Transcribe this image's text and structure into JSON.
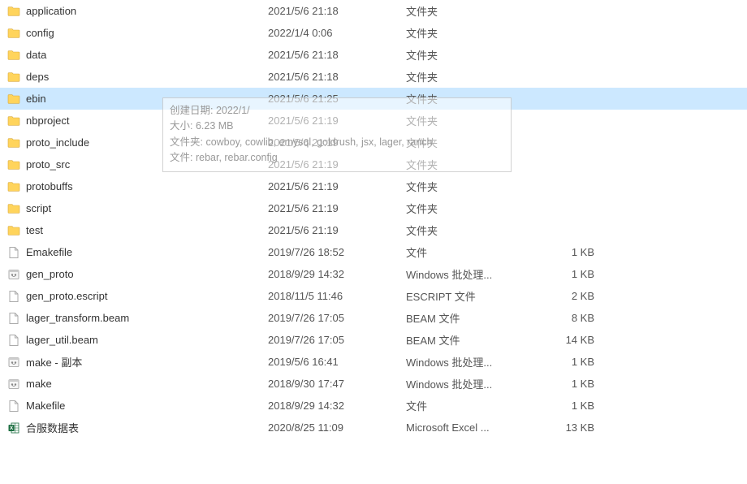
{
  "tooltip": {
    "line1_label": "创建日期: ",
    "line1_value": "2022/1/",
    "line2_label": "大小: ",
    "line2_value": "6.23 MB",
    "line3_label": "文件夹: ",
    "line3_value": "cowboy, cowlib, emysql, goldrush, jsx, lager, ranch",
    "line4_label": "文件: ",
    "line4_value": "rebar, rebar.config"
  },
  "files": [
    {
      "icon": "folder",
      "name": "application",
      "date": "2021/5/6 21:18",
      "type": "文件夹",
      "size": "",
      "selected": false
    },
    {
      "icon": "folder",
      "name": "config",
      "date": "2022/1/4 0:06",
      "type": "文件夹",
      "size": "",
      "selected": false
    },
    {
      "icon": "folder",
      "name": "data",
      "date": "2021/5/6 21:18",
      "type": "文件夹",
      "size": "",
      "selected": false
    },
    {
      "icon": "folder",
      "name": "deps",
      "date": "2021/5/6 21:18",
      "type": "文件夹",
      "size": "",
      "selected": false
    },
    {
      "icon": "folder",
      "name": "ebin",
      "date": "2021/5/6 21:25",
      "type": "文件夹",
      "size": "",
      "selected": true
    },
    {
      "icon": "folder",
      "name": "nbproject",
      "date": "2021/5/6 21:19",
      "type": "文件夹",
      "size": "",
      "selected": false
    },
    {
      "icon": "folder",
      "name": "proto_include",
      "date": "2021/5/6 21:19",
      "type": "文件夹",
      "size": "",
      "selected": false
    },
    {
      "icon": "folder",
      "name": "proto_src",
      "date": "2021/5/6 21:19",
      "type": "文件夹",
      "size": "",
      "selected": false
    },
    {
      "icon": "folder",
      "name": "protobuffs",
      "date": "2021/5/6 21:19",
      "type": "文件夹",
      "size": "",
      "selected": false
    },
    {
      "icon": "folder",
      "name": "script",
      "date": "2021/5/6 21:19",
      "type": "文件夹",
      "size": "",
      "selected": false
    },
    {
      "icon": "folder",
      "name": "test",
      "date": "2021/5/6 21:19",
      "type": "文件夹",
      "size": "",
      "selected": false
    },
    {
      "icon": "file",
      "name": "Emakefile",
      "date": "2019/7/26 18:52",
      "type": "文件",
      "size": "1 KB",
      "selected": false
    },
    {
      "icon": "batch",
      "name": "gen_proto",
      "date": "2018/9/29 14:32",
      "type": "Windows 批处理...",
      "size": "1 KB",
      "selected": false
    },
    {
      "icon": "file",
      "name": "gen_proto.escript",
      "date": "2018/11/5 11:46",
      "type": "ESCRIPT 文件",
      "size": "2 KB",
      "selected": false
    },
    {
      "icon": "file",
      "name": "lager_transform.beam",
      "date": "2019/7/26 17:05",
      "type": "BEAM 文件",
      "size": "8 KB",
      "selected": false
    },
    {
      "icon": "file",
      "name": "lager_util.beam",
      "date": "2019/7/26 17:05",
      "type": "BEAM 文件",
      "size": "14 KB",
      "selected": false
    },
    {
      "icon": "batch",
      "name": "make - 副本",
      "date": "2019/5/6 16:41",
      "type": "Windows 批处理...",
      "size": "1 KB",
      "selected": false
    },
    {
      "icon": "batch",
      "name": "make",
      "date": "2018/9/30 17:47",
      "type": "Windows 批处理...",
      "size": "1 KB",
      "selected": false
    },
    {
      "icon": "file",
      "name": "Makefile",
      "date": "2018/9/29 14:32",
      "type": "文件",
      "size": "1 KB",
      "selected": false
    },
    {
      "icon": "excel",
      "name": "合服数据表",
      "date": "2020/8/25 11:09",
      "type": "Microsoft Excel ...",
      "size": "13 KB",
      "selected": false
    }
  ]
}
